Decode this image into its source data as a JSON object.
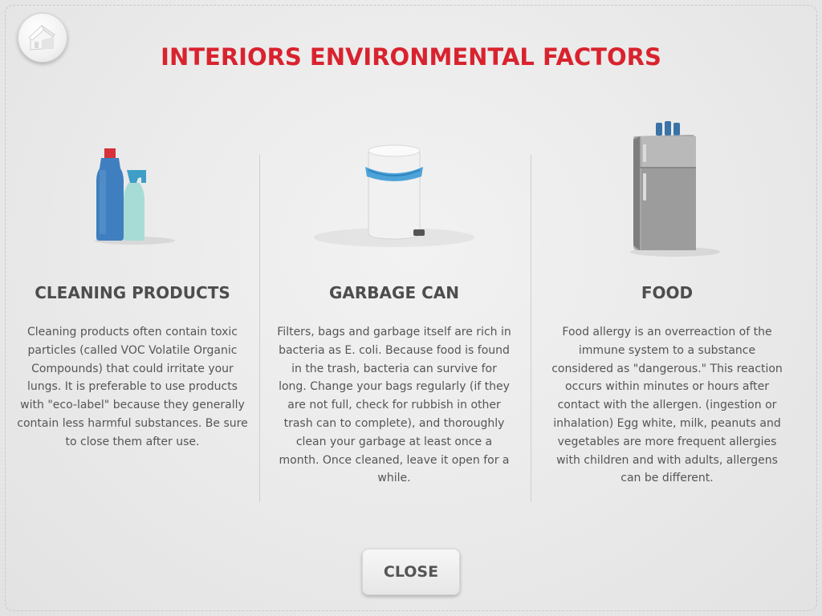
{
  "title": "INTERIORS ENVIRONMENTAL FACTORS",
  "colors": {
    "title": "#d8232e",
    "text": "#555555",
    "background": "#ececec"
  },
  "home_button": {
    "icon": "house-icon"
  },
  "columns": [
    {
      "heading": "CLEANING PRODUCTS",
      "icon": "cleaning-bottles-icon",
      "text": "Cleaning products often contain toxic particles (called VOC Volatile Organic Compounds) that could irritate your lungs. It is preferable to use products with \"eco-label\" because they generally contain less harmful substances. Be sure to close them after use."
    },
    {
      "heading": "GARBAGE CAN",
      "icon": "garbage-can-icon",
      "text": "Filters, bags and garbage itself are rich in bacteria as E. coli.  Because food is found in the trash, bacteria can survive for long. Change your bags regularly (if they are not full, check for rubbish in other trash can to complete), and thoroughly clean your garbage at least once a month. Once cleaned, leave it open for a while."
    },
    {
      "heading": "FOOD",
      "icon": "refrigerator-icon",
      "text": "Food allergy is an overreaction of the immune system to a substance considered as \"dangerous.\" This reaction occurs within minutes or hours after contact  with the allergen. (ingestion or inhalation)  Egg white, milk, peanuts and vegetables are more frequent allergies with children and with adults, allergens can be different."
    }
  ],
  "close_label": "CLOSE"
}
